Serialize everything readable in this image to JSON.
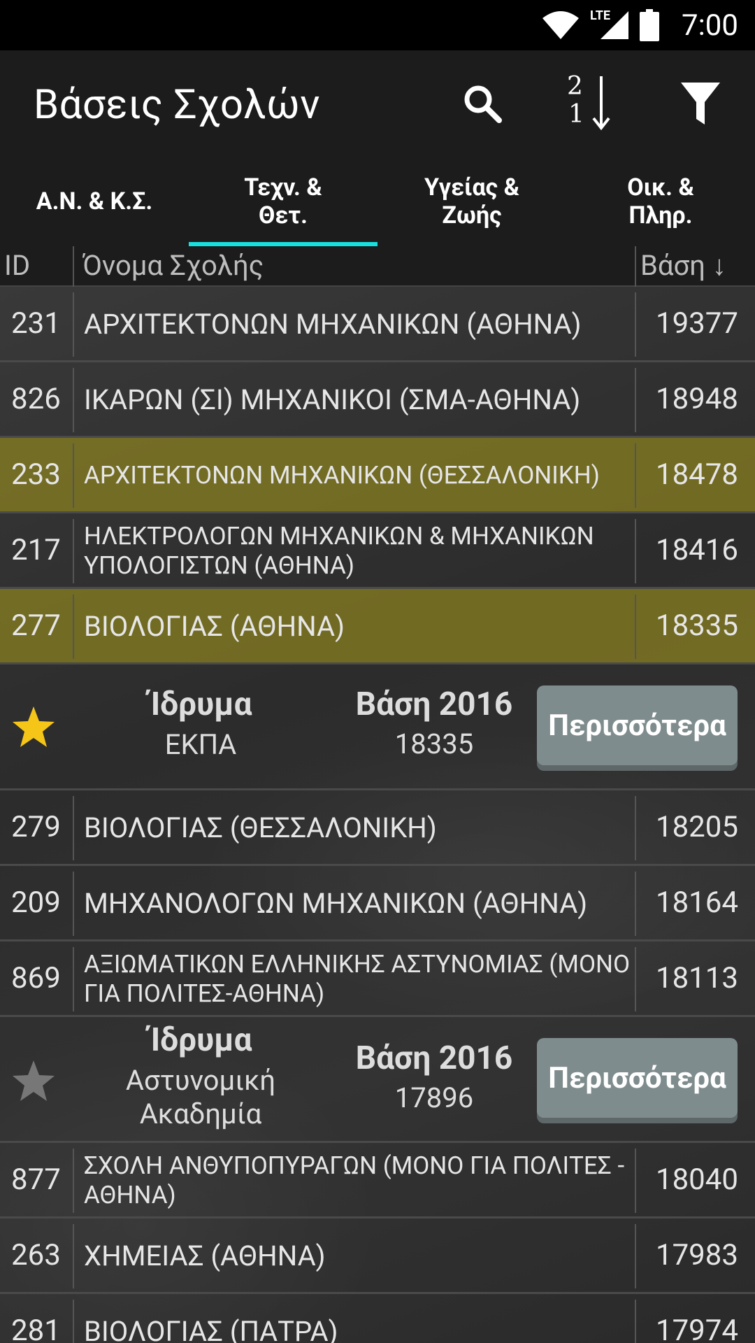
{
  "status_bar": {
    "time": "7:00",
    "network": "LTE"
  },
  "app_bar": {
    "title": "Βάσεις Σχολών",
    "sort_icon_top": "2",
    "sort_icon_bottom": "1"
  },
  "tabs": [
    {
      "label_line1": "Α.Ν. & Κ.Σ.",
      "label_line2": ""
    },
    {
      "label_line1": "Τεχν. &",
      "label_line2": "Θετ."
    },
    {
      "label_line1": "Υγείας &",
      "label_line2": "Ζωής"
    },
    {
      "label_line1": "Οικ. &",
      "label_line2": "Πληρ."
    }
  ],
  "table_header": {
    "id": "ID",
    "name": "Όνομα Σχολής",
    "score": "Βάση ↓"
  },
  "rows": [
    {
      "id": "231",
      "name": "ΑΡΧΙΤΕΚΤΟΝΩΝ ΜΗΧΑΝΙΚΩΝ (ΑΘΗΝΑ)",
      "score": "19377"
    },
    {
      "id": "826",
      "name": "ΙΚΑΡΩΝ (ΣΙ) ΜΗΧΑΝΙΚΟΙ (ΣΜΑ-ΑΘΗΝΑ)",
      "score": "18948"
    },
    {
      "id": "233",
      "name": "ΑΡΧΙΤΕΚΤΟΝΩΝ ΜΗΧΑΝΙΚΩΝ (ΘΕΣΣΑΛΟΝΙΚΗ)",
      "score": "18478"
    },
    {
      "id": "217",
      "name": "ΗΛΕΚΤΡΟΛΟΓΩΝ ΜΗΧΑΝΙΚΩΝ & ΜΗΧΑΝΙΚΩΝ ΥΠΟΛΟΓΙΣΤΩΝ (ΑΘΗΝΑ)",
      "score": "18416"
    },
    {
      "id": "277",
      "name": "ΒΙΟΛΟΓΙΑΣ (ΑΘΗΝΑ)",
      "score": "18335"
    },
    {
      "id": "279",
      "name": "ΒΙΟΛΟΓΙΑΣ (ΘΕΣΣΑΛΟΝΙΚΗ)",
      "score": "18205"
    },
    {
      "id": "209",
      "name": "ΜΗΧΑΝΟΛΟΓΩΝ ΜΗΧΑΝΙΚΩΝ (ΑΘΗΝΑ)",
      "score": "18164"
    },
    {
      "id": "869",
      "name": "ΑΞΙΩΜΑΤΙΚΩΝ ΕΛΛΗΝΙΚΗΣ ΑΣΤΥΝΟΜΙΑΣ (ΜΟΝΟ ΓΙΑ ΠΟΛΙΤΕΣ-ΑΘΗΝΑ)",
      "score": "18113"
    },
    {
      "id": "877",
      "name": "ΣΧΟΛΗ ΑΝΘΥΠΟΠΥΡΑΓΩΝ (ΜΟΝΟ ΓΙΑ ΠΟΛΙΤΕΣ - ΑΘΗΝΑ)",
      "score": "18040"
    },
    {
      "id": "263",
      "name": "ΧΗΜΕΙΑΣ (ΑΘΗΝΑ)",
      "score": "17983"
    },
    {
      "id": "281",
      "name": "ΒΙΟΛΟΓΙΑΣ (ΠΑΤΡΑ)",
      "score": "17974"
    }
  ],
  "details": [
    {
      "institution_label": "Ίδρυμα",
      "institution_line1": "ΕΚΠΑ",
      "institution_line2": "",
      "base_label": "Βάση 2016",
      "base_value": "18335",
      "more_label": "Περισσότερα",
      "favorite": true
    },
    {
      "institution_label": "Ίδρυμα",
      "institution_line1": "Αστυνομική",
      "institution_line2": "Ακαδημία",
      "base_label": "Βάση 2016",
      "base_value": "17896",
      "more_label": "Περισσότερα",
      "favorite": false
    }
  ],
  "colors": {
    "accent": "#18e0e0",
    "highlight": "#968c1e",
    "star_on": "#f5c518",
    "star_off": "#777777",
    "button": "#7f8c8d"
  }
}
